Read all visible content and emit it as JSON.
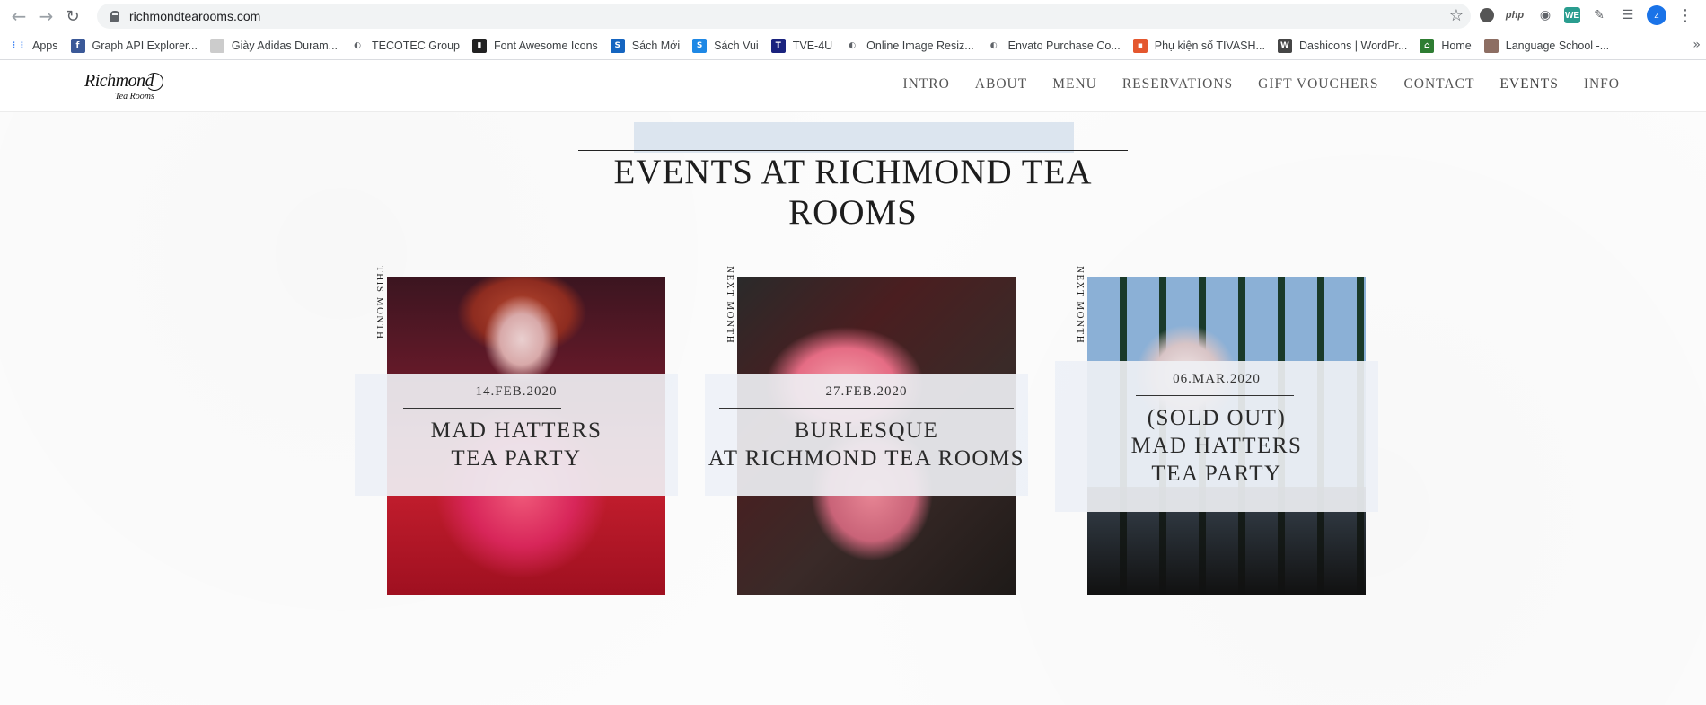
{
  "browser": {
    "url": "richmondtearooms.com",
    "bookmarks": [
      {
        "label": "Apps",
        "icon": "apps-grid-icon",
        "color": "#4285f4"
      },
      {
        "label": "Graph API Explorer...",
        "icon": "facebook-icon",
        "color": "#3b5998"
      },
      {
        "label": "Giày Adidas Duram...",
        "icon": "page-icon",
        "color": "#cccccc"
      },
      {
        "label": "TECOTEC Group",
        "icon": "globe-icon",
        "color": "#5f6368"
      },
      {
        "label": "Font Awesome Icons",
        "icon": "flag-icon",
        "color": "#222222"
      },
      {
        "label": "Sách Mới",
        "icon": "s-icon",
        "color": "#1565c0"
      },
      {
        "label": "Sách Vui",
        "icon": "s-icon",
        "color": "#1e88e5"
      },
      {
        "label": "TVE-4U",
        "icon": "tve-icon",
        "color": "#1a237e"
      },
      {
        "label": "Online Image Resiz...",
        "icon": "globe-icon",
        "color": "#5f6368"
      },
      {
        "label": "Envato Purchase Co...",
        "icon": "globe-icon",
        "color": "#5f6368"
      },
      {
        "label": "Phụ kiện số TIVASH...",
        "icon": "bag-icon",
        "color": "#e4572e"
      },
      {
        "label": "Dashicons | WordPr...",
        "icon": "wordpress-icon",
        "color": "#464646"
      },
      {
        "label": "Home",
        "icon": "home-icon",
        "color": "#2e7d32"
      },
      {
        "label": "Language School -...",
        "icon": "page-icon",
        "color": "#8d6e63"
      }
    ],
    "more": "»"
  },
  "site": {
    "logo": {
      "line1": "Richmond",
      "line2": "Tea Rooms"
    },
    "nav": [
      "INTRO",
      "ABOUT",
      "MENU",
      "RESERVATIONS",
      "GIFT VOUCHERS",
      "CONTACT",
      "EVENTS",
      "INFO"
    ],
    "active_nav": "EVENTS",
    "title": "EVENTS AT RICHMOND TEA ROOMS"
  },
  "events": [
    {
      "tag": "THIS MONTH",
      "date": "14.FEB.2020",
      "name_lines": [
        "MAD HATTERS",
        "TEA PARTY"
      ]
    },
    {
      "tag": "NEXT MONTH",
      "date": "27.FEB.2020",
      "name_lines": [
        "BURLESQUE",
        "AT RICHMOND TEA ROOMS"
      ]
    },
    {
      "tag": "NEXT MONTH",
      "date": "06.MAR.2020",
      "name_lines": [
        "(SOLD OUT)",
        "MAD HATTERS",
        "TEA PARTY"
      ]
    }
  ]
}
